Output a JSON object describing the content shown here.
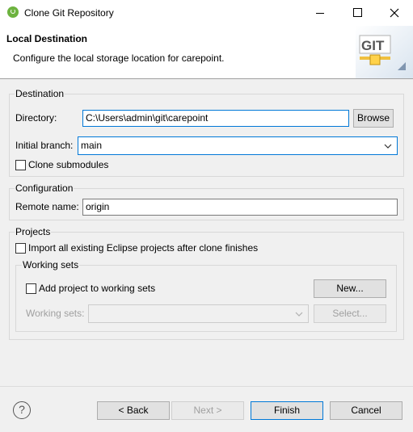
{
  "window": {
    "title": "Clone Git Repository"
  },
  "header": {
    "title": "Local Destination",
    "description": "Configure the local storage location for carepoint.",
    "logo_text": "GIT"
  },
  "destination": {
    "group_label": "Destination",
    "directory_label": "Directory:",
    "directory_value": "C:\\Users\\admin\\git\\carepoint",
    "browse_label": "Browse",
    "initial_branch_label": "Initial branch:",
    "initial_branch_value": "main",
    "clone_submodules_label": "Clone submodules"
  },
  "configuration": {
    "group_label": "Configuration",
    "remote_name_label": "Remote name:",
    "remote_name_value": "origin"
  },
  "projects": {
    "group_label": "Projects",
    "import_label": "Import all existing Eclipse projects after clone finishes",
    "working_sets": {
      "group_label": "Working sets",
      "add_label": "Add project to working sets",
      "new_label": "New...",
      "working_sets_label": "Working sets:",
      "working_sets_value": "",
      "select_label": "Select..."
    }
  },
  "footer": {
    "help_icon_glyph": "?",
    "back_label": "< Back",
    "next_label": "Next >",
    "finish_label": "Finish",
    "cancel_label": "Cancel"
  }
}
